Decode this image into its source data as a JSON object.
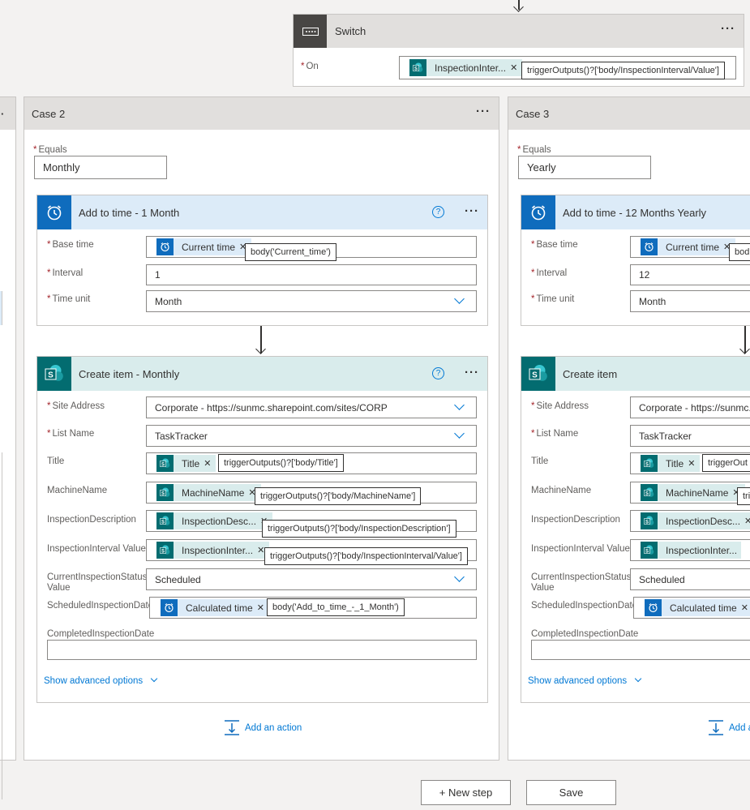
{
  "switch": {
    "title": "Switch",
    "on_label": "On",
    "token": "InspectionInter...",
    "tip": "triggerOutputs()?['body/InspectionInterval/Value']"
  },
  "case2": {
    "title": "Case 2",
    "equals_label": "Equals",
    "equals_value": "Monthly",
    "add_time": {
      "title": "Add to time - 1 Month",
      "base_time_label": "Base time",
      "base_time_token": "Current time",
      "base_time_tip": "body('Current_time')",
      "interval_label": "Interval",
      "interval_value": "1",
      "time_unit_label": "Time unit",
      "time_unit_value": "Month"
    },
    "create": {
      "title": "Create item - Monthly",
      "site_label": "Site Address",
      "site_value": "Corporate - https://sunmc.sharepoint.com/sites/CORP",
      "list_label": "List Name",
      "list_value": "TaskTracker",
      "title_label": "Title",
      "title_token": "Title",
      "title_tip": "triggerOutputs()?['body/Title']",
      "machine_label": "MachineName",
      "machine_token": "MachineName",
      "machine_tip": "triggerOutputs()?['body/MachineName']",
      "desc_label": "InspectionDescription",
      "desc_token": "InspectionDesc...",
      "desc_tip": "triggerOutputs()?['body/InspectionDescription']",
      "interval_label": "InspectionInterval Value",
      "interval_token": "InspectionInter...",
      "interval_tip": "triggerOutputs()?['body/InspectionInterval/Value']",
      "status_label_1": "CurrentInspectionStatus",
      "status_label_2": "Value",
      "status_value": "Scheduled",
      "sched_label": "ScheduledInspectionDate",
      "sched_token": "Calculated time",
      "sched_tip": "body('Add_to_time_-_1_Month')",
      "completed_label": "CompletedInspectionDate",
      "advanced": "Show advanced options"
    },
    "add_action": "Add an action"
  },
  "case3": {
    "title": "Case 3",
    "equals_label": "Equals",
    "equals_value": "Yearly",
    "add_time": {
      "title": "Add to time - 12 Months Yearly",
      "base_time_label": "Base time",
      "base_time_token": "Current time",
      "base_time_tip": "bod",
      "interval_label": "Interval",
      "interval_value": "12",
      "time_unit_label": "Time unit",
      "time_unit_value": "Month"
    },
    "create": {
      "title": "Create item",
      "site_label": "Site Address",
      "site_value": "Corporate - https://sunmc.sh",
      "list_label": "List Name",
      "list_value": "TaskTracker",
      "title_label": "Title",
      "title_token": "Title",
      "title_tip": "triggerOut",
      "machine_label": "MachineName",
      "machine_token": "MachineName",
      "machine_tip": "tri",
      "desc_label": "InspectionDescription",
      "desc_token": "InspectionDesc...",
      "interval_label": "InspectionInterval Value",
      "interval_token": "InspectionInter...",
      "status_label_1": "CurrentInspectionStatus",
      "status_label_2": "Value",
      "status_value": "Scheduled",
      "sched_label": "ScheduledInspectionDate",
      "sched_token": "Calculated time",
      "completed_label": "CompletedInspectionDate",
      "advanced": "Show advanced options"
    },
    "add_action": "Add a"
  },
  "bottom": {
    "new_step": "+ New step",
    "save": "Save"
  },
  "colors": {
    "sharepoint": "#036c70",
    "clock": "#0f6cbd",
    "accent": "#0078d4",
    "required": "#a4262c"
  },
  "icons": [
    "switch-icon",
    "sharepoint-icon",
    "clock-icon",
    "help-icon",
    "chevron-down-icon",
    "add-action-icon",
    "more-options-icon"
  ]
}
